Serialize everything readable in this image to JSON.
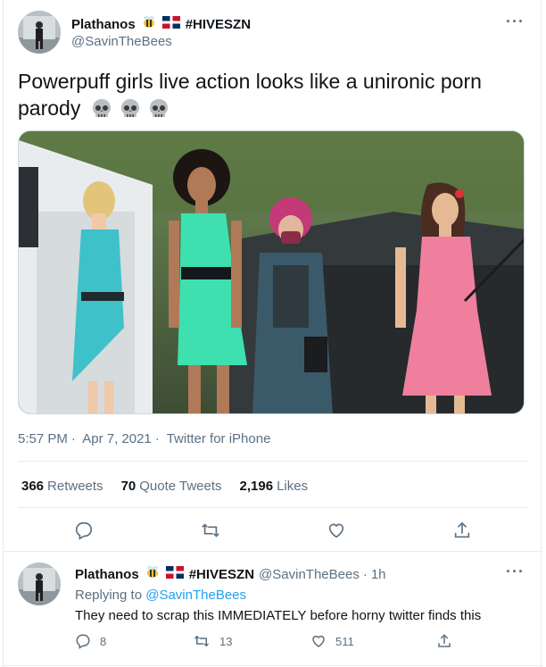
{
  "main_tweet": {
    "author_name": "Plathanos",
    "author_handle": "@SavinTheBees",
    "author_tag": "#HIVESZN",
    "badges": [
      "bee-icon",
      "dominican-flag-icon"
    ],
    "text": "Powerpuff girls live action looks like a unironic porn parody",
    "trailing_emoji": [
      "skull-icon",
      "skull-icon",
      "skull-icon"
    ],
    "time": "5:57 PM",
    "date": "Apr 7, 2021",
    "source": "Twitter for iPhone",
    "separator": "·",
    "stats": {
      "retweets_count": "366",
      "retweets_label": "Retweets",
      "quotes_count": "70",
      "quotes_label": "Quote Tweets",
      "likes_count": "2,196",
      "likes_label": "Likes"
    },
    "actions": [
      "reply-icon",
      "retweet-icon",
      "like-icon",
      "share-icon"
    ],
    "more_label": "···"
  },
  "reply_tweet": {
    "author_name": "Plathanos",
    "author_tag": "#HIVESZN",
    "author_handle": "@SavinTheBees",
    "time_ago": "1h",
    "separator": "·",
    "replying_to_label": "Replying to",
    "replying_to_handle": "@SavinTheBees",
    "text": "They need to scrap this IMMEDIATELY before horny twitter finds this",
    "reply_count": "8",
    "retweet_count": "13",
    "like_count": "511",
    "more_label": "···"
  },
  "colors": {
    "accent": "#1da1f2",
    "muted_text": "#5b7083",
    "primary_text": "#0f1419",
    "divider": "#e6ecf0"
  }
}
